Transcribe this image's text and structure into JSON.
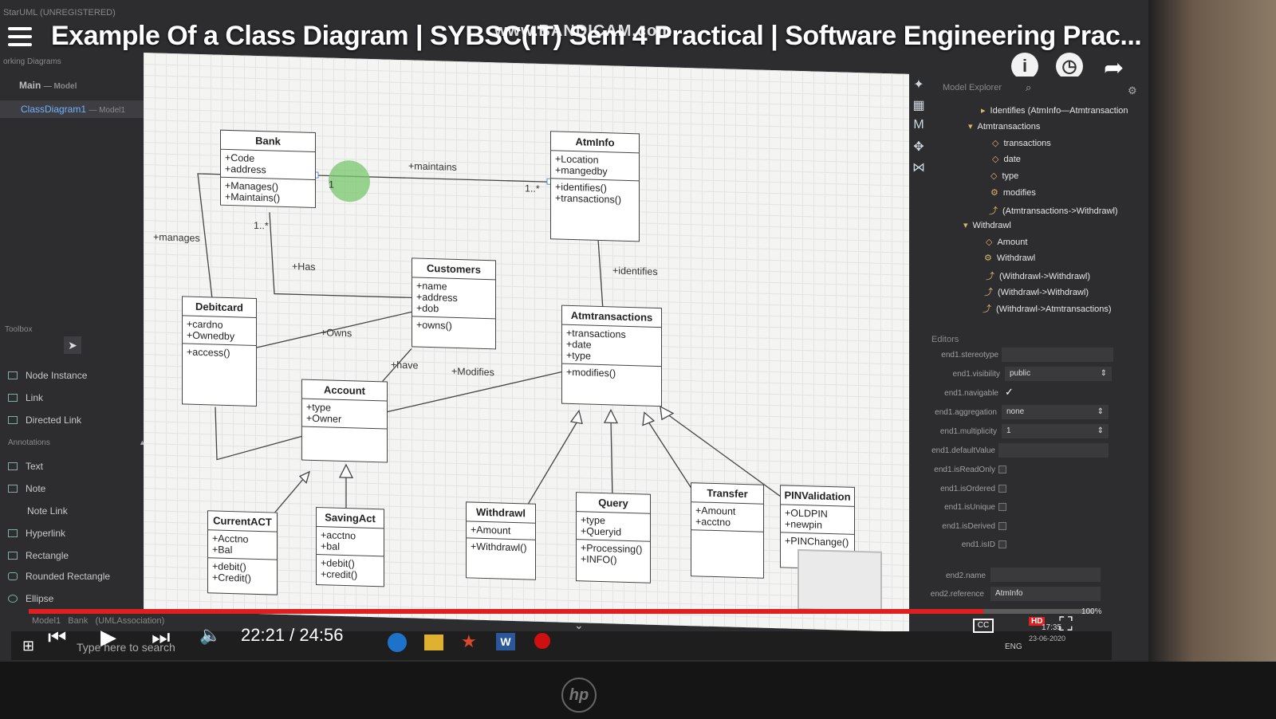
{
  "app_title": "StarUML (UNREGISTERED)",
  "video": {
    "title": "Example Of a Class Diagram | SYBSC(IT) Sem 4 Practical | Software Engineering Prac...",
    "watermark": "www.BANDICAM.com",
    "time": "22:21 / 24:56",
    "progress": 0.896
  },
  "left_panel": {
    "working_diagrams": "orking Diagrams",
    "main": "Main",
    "main_model": "— Model",
    "class_diagram": "ClassDiagram1",
    "class_diagram_model": "— Model1"
  },
  "toolbox": {
    "title": "Toolbox",
    "items": [
      "Node Instance",
      "Link",
      "Directed Link"
    ],
    "annotations_title": "Annotations",
    "annotation_items": [
      "Text",
      "Note",
      "Note Link",
      "Hyperlink",
      "Rectangle",
      "Rounded Rectangle",
      "Ellipse"
    ]
  },
  "diagram": {
    "classes": {
      "bank": {
        "name": "Bank",
        "attrs": [
          "+Code",
          "+address"
        ],
        "ops": [
          "+Manages()",
          "+Maintains()"
        ]
      },
      "atminfo": {
        "name": "AtmInfo",
        "attrs": [
          "+Location",
          "+mangedby"
        ],
        "ops": [
          "+identifies()",
          "+transactions()"
        ]
      },
      "customers": {
        "name": "Customers",
        "attrs": [
          "+name",
          "+address",
          "+dob"
        ],
        "ops": [
          "+owns()"
        ]
      },
      "debitcard": {
        "name": "Debitcard",
        "attrs": [
          "+cardno",
          "+Ownedby"
        ],
        "ops": [
          "+access()"
        ]
      },
      "atmtransactions": {
        "name": "Atmtransactions",
        "attrs": [
          "+transactions",
          "+date",
          "+type"
        ],
        "ops": [
          "+modifies()"
        ]
      },
      "account": {
        "name": "Account",
        "attrs": [
          "+type",
          "+Owner"
        ],
        "ops": []
      },
      "currentact": {
        "name": "CurrentACT",
        "attrs": [
          "+Acctno",
          "+Bal"
        ],
        "ops": [
          "+debit()",
          "+Credit()"
        ]
      },
      "savingact": {
        "name": "SavingAct",
        "attrs": [
          "+acctno",
          "+bal"
        ],
        "ops": [
          "+debit()",
          "+credit()"
        ]
      },
      "withdrawl": {
        "name": "Withdrawl",
        "attrs": [
          "+Amount"
        ],
        "ops": [
          "+Withdrawl()"
        ]
      },
      "query": {
        "name": "Query",
        "attrs": [
          "+type",
          "+Queryid"
        ],
        "ops": [
          "+Processing()",
          "+INFO()"
        ]
      },
      "transfer": {
        "name": "Transfer",
        "attrs": [
          "+Amount",
          "+acctno"
        ],
        "ops": []
      },
      "pinvalidation": {
        "name": "PINValidation",
        "attrs": [
          "+OLDPIN",
          "+newpin"
        ],
        "ops": [
          "+PINChange()"
        ]
      }
    },
    "labels": {
      "maintains": "+maintains",
      "mult_one": "1",
      "mult_many_a": "1..*",
      "mult_many_b": "1..*",
      "manages": "+manages",
      "has": "+Has",
      "identifies": "+identifies",
      "owns": "+Owns",
      "have": "+have",
      "modifies": "+Modifies"
    }
  },
  "explorer": {
    "title": "Model Explorer",
    "rows": [
      "Identifies (AtmInfo—Atmtransaction",
      "Atmtransactions",
      "transactions",
      "date",
      "type",
      "modifies",
      "(Atmtransactions->Withdrawl)",
      "Withdrawl",
      "Amount",
      "Withdrawl",
      "(Withdrawl->Withdrawl)",
      "(Withdrawl->Withdrawl)",
      "(Withdrawl->Atmtransactions)"
    ]
  },
  "editors": {
    "title": "Editors",
    "fields": [
      {
        "label": "end1.stereotype",
        "value": ""
      },
      {
        "label": "end1.visibility",
        "value": "public"
      },
      {
        "label": "end1.navigable",
        "value": "✓"
      },
      {
        "label": "end1.aggregation",
        "value": "none"
      },
      {
        "label": "end1.multiplicity",
        "value": "1"
      },
      {
        "label": "end1.defaultValue",
        "value": ""
      },
      {
        "label": "end1.isReadOnly",
        "value": ""
      },
      {
        "label": "end1.isOrdered",
        "value": ""
      },
      {
        "label": "end1.isUnique",
        "value": ""
      },
      {
        "label": "end1.isDerived",
        "value": ""
      },
      {
        "label": "end1.isID",
        "value": ""
      },
      {
        "label": "end2.name",
        "value": ""
      },
      {
        "label": "end2.reference",
        "value": "AtmInfo"
      }
    ]
  },
  "status_bar": {
    "model": "Model1",
    "element": "Bank",
    "assoc": "(UMLAssociation)"
  },
  "taskbar": {
    "search": "Type here to search",
    "lang": "ENG",
    "clock": "17:35",
    "date": "23-06-2020",
    "zoom": "100%",
    "hd": "HD",
    "cc": "CC"
  }
}
